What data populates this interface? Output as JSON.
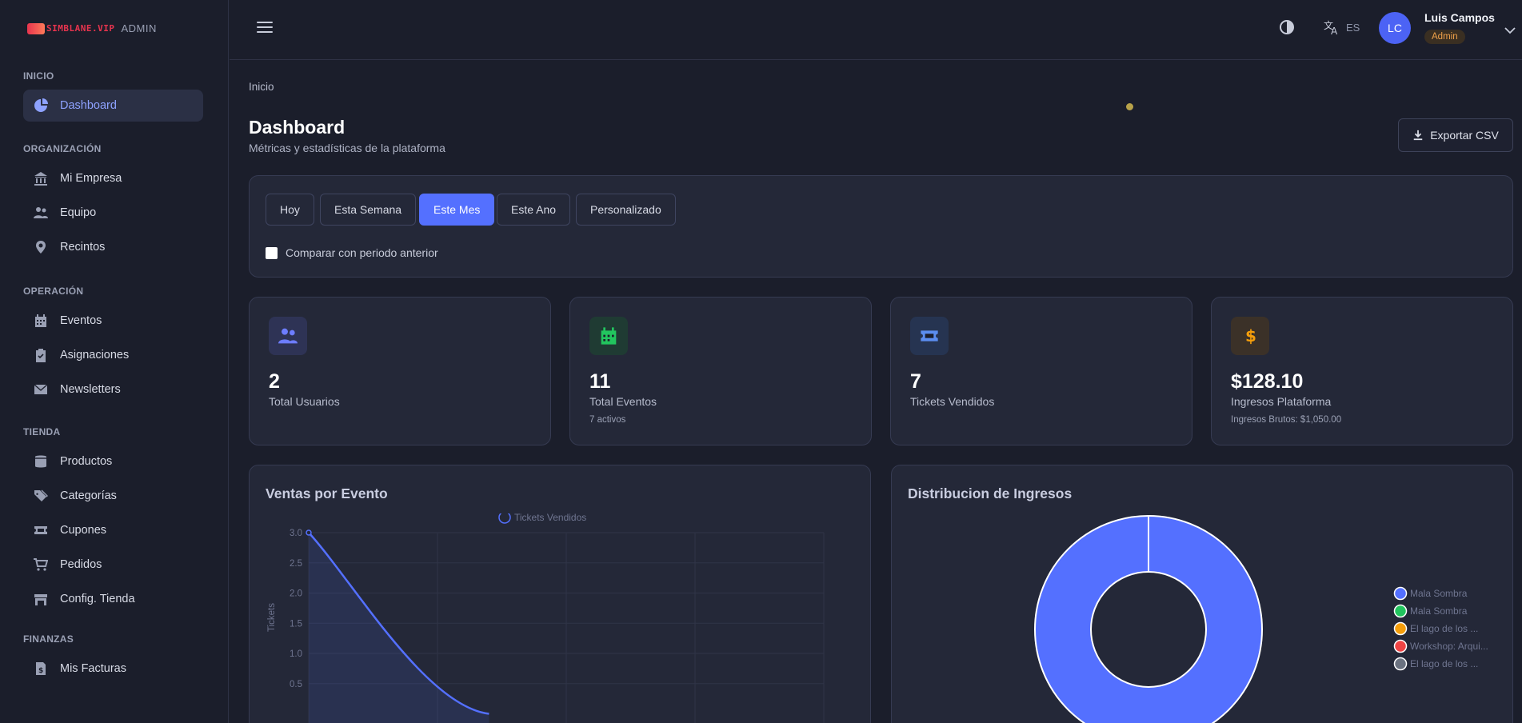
{
  "brand": {
    "logo_text": "SIMBLANE.VIP",
    "admin_label": "ADMIN"
  },
  "sidebar": {
    "sections": [
      {
        "title": "INICIO",
        "items": [
          {
            "label": "Dashboard",
            "icon": "chart-pie-icon",
            "active": true
          }
        ]
      },
      {
        "title": "ORGANIZACIÓN",
        "items": [
          {
            "label": "Mi Empresa",
            "icon": "building-icon"
          },
          {
            "label": "Equipo",
            "icon": "users-icon"
          },
          {
            "label": "Recintos",
            "icon": "map-pin-icon"
          }
        ]
      },
      {
        "title": "OPERACIÓN",
        "items": [
          {
            "label": "Eventos",
            "icon": "calendar-icon"
          },
          {
            "label": "Asignaciones",
            "icon": "clipboard-icon"
          },
          {
            "label": "Newsletters",
            "icon": "envelope-icon"
          }
        ]
      },
      {
        "title": "TIENDA",
        "items": [
          {
            "label": "Productos",
            "icon": "box-icon"
          },
          {
            "label": "Categorías",
            "icon": "tags-icon"
          },
          {
            "label": "Cupones",
            "icon": "ticket-icon"
          },
          {
            "label": "Pedidos",
            "icon": "cart-icon"
          },
          {
            "label": "Config. Tienda",
            "icon": "store-icon"
          }
        ]
      },
      {
        "title": "FINANZAS",
        "items": [
          {
            "label": "Mis Facturas",
            "icon": "invoice-icon"
          }
        ]
      }
    ]
  },
  "topbar": {
    "language": "ES",
    "user": {
      "initials": "LC",
      "name": "Luis Campos",
      "role": "Admin"
    }
  },
  "breadcrumb": "Inicio",
  "page": {
    "title": "Dashboard",
    "subtitle": "Métricas y estadísticas de la plataforma",
    "export_label": "Exportar CSV"
  },
  "filters": {
    "periods": [
      "Hoy",
      "Esta Semana",
      "Este Mes",
      "Este Ano",
      "Personalizado"
    ],
    "active_period": "Este Mes",
    "compare_label": "Comparar con periodo anterior",
    "compare_checked": false
  },
  "stats": [
    {
      "value": "2",
      "label": "Total Usuarios",
      "sub": "",
      "icon": "users-icon",
      "color": "#6d7dff"
    },
    {
      "value": "11",
      "label": "Total Eventos",
      "sub": "7 activos",
      "icon": "calendar-icon",
      "color": "#22c55e"
    },
    {
      "value": "7",
      "label": "Tickets Vendidos",
      "sub": "",
      "icon": "ticket-icon",
      "color": "#5b8def"
    },
    {
      "value": "$128.10",
      "label": "Ingresos Plataforma",
      "sub": "Ingresos Brutos: $1,050.00",
      "icon": "dollar-icon",
      "color": "#f59e0b"
    }
  ],
  "charts": {
    "sales_title": "Ventas por Evento",
    "revenue_title": "Distribucion de Ingresos"
  },
  "chart_data": [
    {
      "type": "line",
      "title": "Ventas por Evento",
      "ylabel": "Tickets",
      "series": [
        {
          "name": "Tickets Vendidos",
          "values": [
            3.0,
            0.0
          ],
          "color": "#5470ff"
        }
      ],
      "x_index": [
        0,
        1
      ],
      "yticks": [
        "3.0",
        "2.5",
        "2.0",
        "1.5",
        "1.0",
        "0.5"
      ],
      "ylim": [
        0,
        3.0
      ],
      "grid": true,
      "legend": "top"
    },
    {
      "type": "pie",
      "title": "Distribucion de Ingresos",
      "donut": true,
      "labels": [
        "Mala Sombra",
        "Mala Sombra",
        "El lago de los ...",
        "Workshop: Arqui...",
        "El lago de los ..."
      ],
      "values": [
        1,
        0,
        0,
        0,
        0
      ],
      "colors": [
        "#5470ff",
        "#22c55e",
        "#f59e0b",
        "#ef4444",
        "#6b7280"
      ],
      "legend": "right"
    }
  ]
}
